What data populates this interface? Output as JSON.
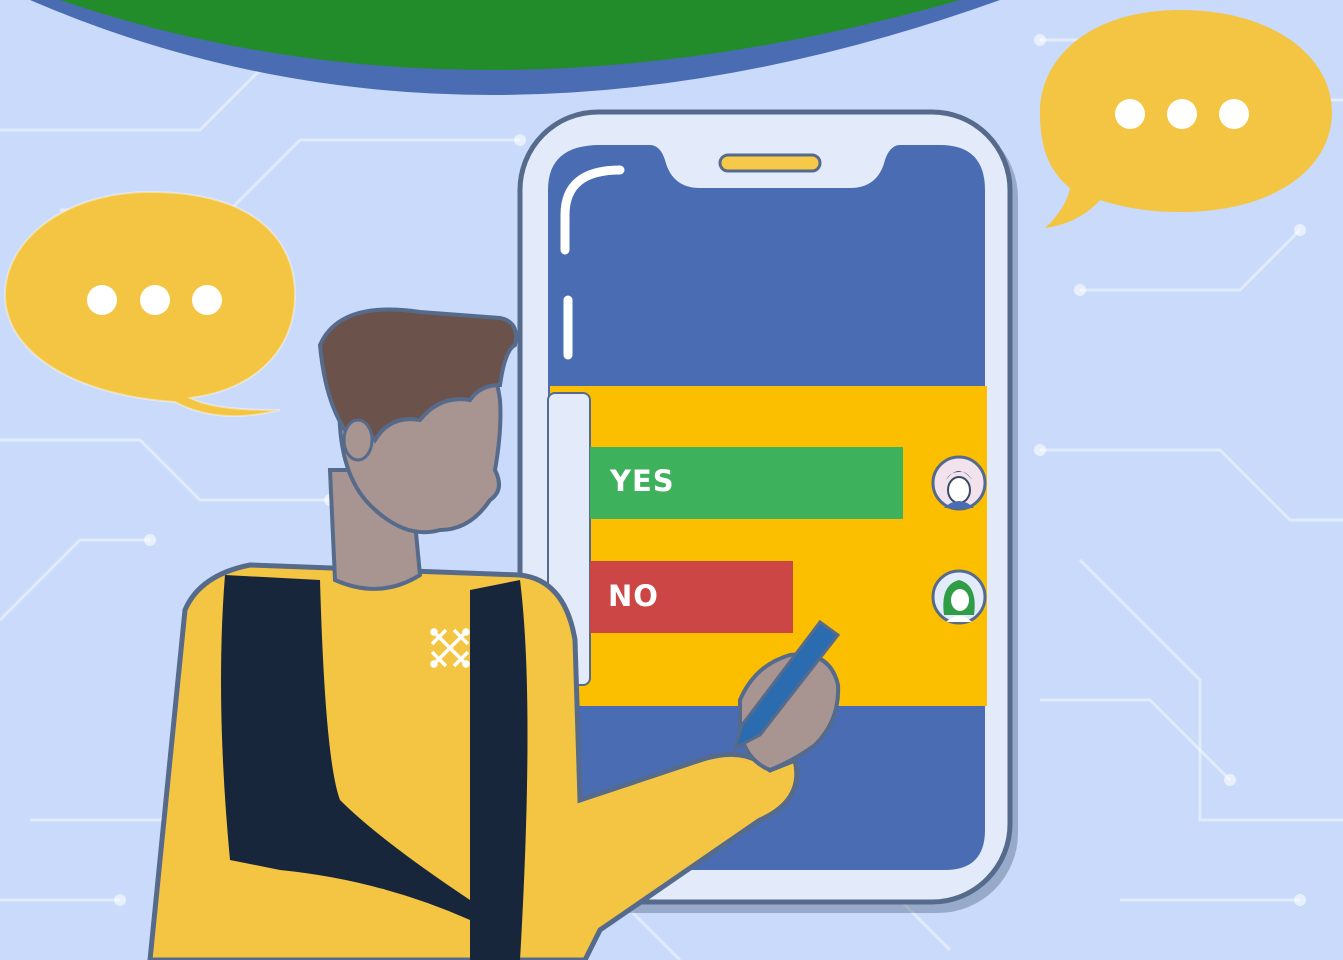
{
  "poll": {
    "options": [
      {
        "label": "YES",
        "color": "#3db15b",
        "fraction": 1.0,
        "avatar": "male-avatar-icon"
      },
      {
        "label": "NO",
        "color": "#cc4646",
        "fraction": 0.65,
        "avatar": "female-avatar-icon"
      }
    ],
    "panel_color": "#fbbf00"
  },
  "bubbles": [
    {
      "icon": "typing-ellipsis-icon",
      "color": "#f7c948"
    },
    {
      "icon": "typing-ellipsis-icon",
      "color": "#f7c948"
    }
  ],
  "colors": {
    "background": "#c9dafa",
    "screen": "#4a6cb3",
    "header_arc_green": "#238c2a",
    "header_arc_blue": "#4a6cb3",
    "shirt": "#f4c542",
    "vest": "#18263b",
    "skin": "#a89490",
    "hair": "#6b524b"
  }
}
